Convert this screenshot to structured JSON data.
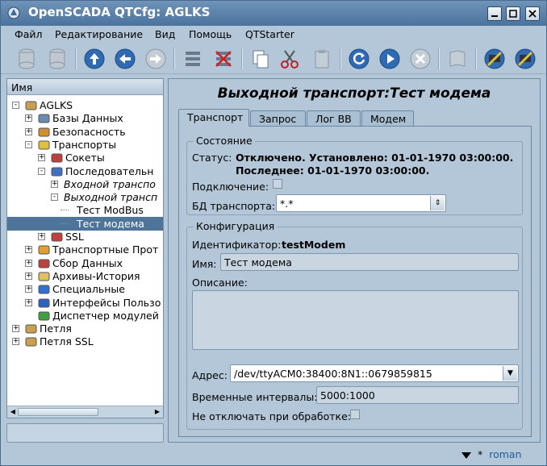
{
  "window": {
    "title": "OpenSCADA QTCfg: AGLKS"
  },
  "menu": [
    "Файл",
    "Редактирование",
    "Вид",
    "Помощь",
    "QTStarter"
  ],
  "tree": {
    "header": "Имя",
    "items": [
      {
        "label": "AGLKS",
        "level": 0,
        "exp": "-",
        "icon": "folder-icon",
        "italic": false
      },
      {
        "label": "Базы Данных",
        "level": 1,
        "exp": "+",
        "icon": "database-icon",
        "italic": false
      },
      {
        "label": "Безопасность",
        "level": 1,
        "exp": "+",
        "icon": "security-icon",
        "italic": false
      },
      {
        "label": "Транспорты",
        "level": 1,
        "exp": "-",
        "icon": "transport-icon",
        "italic": false
      },
      {
        "label": "Сокеты",
        "level": 2,
        "exp": "+",
        "icon": "sockets-icon",
        "italic": false
      },
      {
        "label": "Последовательн",
        "level": 2,
        "exp": "-",
        "icon": "serial-icon",
        "italic": false
      },
      {
        "label": "Входной транспо",
        "level": 3,
        "exp": "+",
        "icon": "",
        "italic": true
      },
      {
        "label": "Выходной трансп",
        "level": 3,
        "exp": "-",
        "icon": "",
        "italic": true
      },
      {
        "label": "Тест ModBus",
        "level": 4,
        "exp": "",
        "icon": "",
        "italic": false
      },
      {
        "label": "Тест модема",
        "level": 4,
        "exp": "",
        "icon": "",
        "italic": false,
        "selected": true
      },
      {
        "label": "SSL",
        "level": 2,
        "exp": "+",
        "icon": "ssl-icon",
        "italic": false
      },
      {
        "label": "Транспортные Прот",
        "level": 1,
        "exp": "+",
        "icon": "protocol-icon",
        "italic": false
      },
      {
        "label": "Сбор Данных",
        "level": 1,
        "exp": "+",
        "icon": "daq-icon",
        "italic": false
      },
      {
        "label": "Архивы-История",
        "level": 1,
        "exp": "+",
        "icon": "archive-icon",
        "italic": false
      },
      {
        "label": "Специальные",
        "level": 1,
        "exp": "+",
        "icon": "special-icon",
        "italic": false
      },
      {
        "label": "Интерфейсы Пользо",
        "level": 1,
        "exp": "+",
        "icon": "ui-icon",
        "italic": false
      },
      {
        "label": "Диспетчер модулей",
        "level": 1,
        "exp": "",
        "icon": "modules-icon",
        "italic": false
      },
      {
        "label": "Петля",
        "level": 0,
        "exp": "+",
        "icon": "folder-icon",
        "italic": false
      },
      {
        "label": "Петля SSL",
        "level": 0,
        "exp": "+",
        "icon": "folder-icon",
        "italic": false
      }
    ]
  },
  "page": {
    "title": "Выходной транспорт:Тест модема",
    "tabs": [
      "Транспорт",
      "Запрос",
      "Лог ВВ",
      "Модем"
    ],
    "state": {
      "group": "Состояние",
      "status_label": "Статус:",
      "status_line1": "Отключено. Установлено: 01-01-1970 03:00:00.",
      "status_line2": "Последнее: 01-01-1970 03:00:00.",
      "connect_label": "Подключение:",
      "db_label": "БД транспорта:",
      "db_value": "*.*"
    },
    "config": {
      "group": "Конфигурация",
      "id_label": "Идентификатор:",
      "id_value": "testModem",
      "name_label": "Имя:",
      "name_value": "Тест модема",
      "descr_label": "Описание:",
      "addr_label": "Адрес:",
      "addr_value": "/dev/ttyACM0:38400:8N1::0679859815",
      "timeouts_label": "Временные интервалы:",
      "timeouts_value": "5000:1000",
      "nodisc_label": "Не отключать при обработке:"
    }
  },
  "footer": {
    "star": "*",
    "user": "roman"
  },
  "colors": {
    "title_grad_top": "#6f93b8",
    "selection": "#4f7499",
    "panel": "#b3c7d8"
  }
}
